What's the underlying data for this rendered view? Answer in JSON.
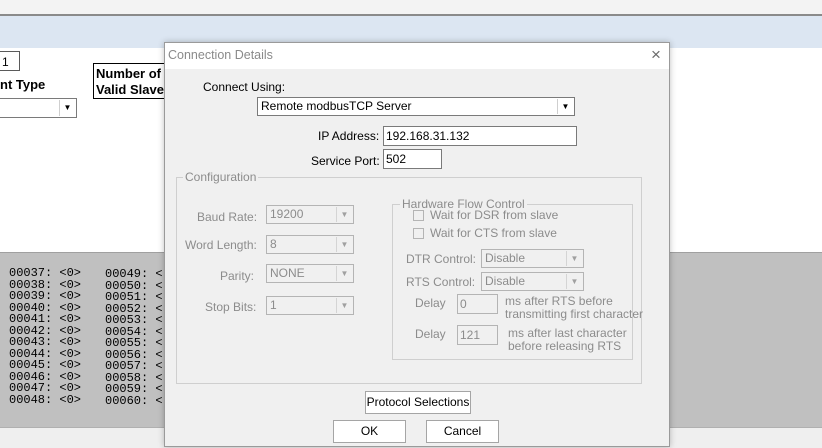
{
  "background": {
    "count_value": "1",
    "type_label": "nt Type",
    "slaves_label_line1": "Number of",
    "slaves_label_line2": "Valid Slave",
    "register_rows": [
      {
        "a": "00037: <0>",
        "b": "00049: <"
      },
      {
        "a": "00038: <0>",
        "b": "00050: <"
      },
      {
        "a": "00039: <0>",
        "b": "00051: <"
      },
      {
        "a": "00040: <0>",
        "b": "00052: <"
      },
      {
        "a": "00041: <0>",
        "b": "00053: <"
      },
      {
        "a": "00042: <0>",
        "b": "00054: <"
      },
      {
        "a": "00043: <0>",
        "b": "00055: <"
      },
      {
        "a": "00044: <0>",
        "b": "00056: <"
      },
      {
        "a": "00045: <0>",
        "b": "00057: <"
      },
      {
        "a": "00046: <0>",
        "b": "00058: <"
      },
      {
        "a": "00047: <0>",
        "b": "00059: <"
      },
      {
        "a": "00048: <0>",
        "b": "00060: <"
      }
    ]
  },
  "dialog": {
    "title": "Connection Details",
    "close_glyph": "×",
    "connect_using_label": "Connect Using:",
    "connect_using_value": "Remote modbusTCP Server",
    "ip_label": "IP Address:",
    "ip_value": "192.168.31.132",
    "port_label": "Service Port:",
    "port_value": "502",
    "configuration": {
      "title": "Configuration",
      "baud_label": "Baud Rate:",
      "baud_value": "19200",
      "word_label": "Word Length:",
      "word_value": "8",
      "parity_label": "Parity:",
      "parity_value": "NONE",
      "stop_label": "Stop Bits:",
      "stop_value": "1"
    },
    "hardware_flow": {
      "title": "Hardware Flow Control",
      "wait_dsr": "Wait for DSR from slave",
      "wait_cts": "Wait for CTS from slave",
      "dtr_label": "DTR Control:",
      "dtr_value": "Disable",
      "rts_label": "RTS Control:",
      "rts_value": "Disable",
      "delay1_label": "Delay",
      "delay1_value": "0",
      "delay1_note_1": "ms after RTS before",
      "delay1_note_2": "transmitting first character",
      "delay2_label": "Delay",
      "delay2_value": "121",
      "delay2_note_1": "ms after last character",
      "delay2_note_2": "before releasing RTS"
    },
    "protocol_button": "Protocol Selections",
    "ok_button": "OK",
    "cancel_button": "Cancel"
  }
}
